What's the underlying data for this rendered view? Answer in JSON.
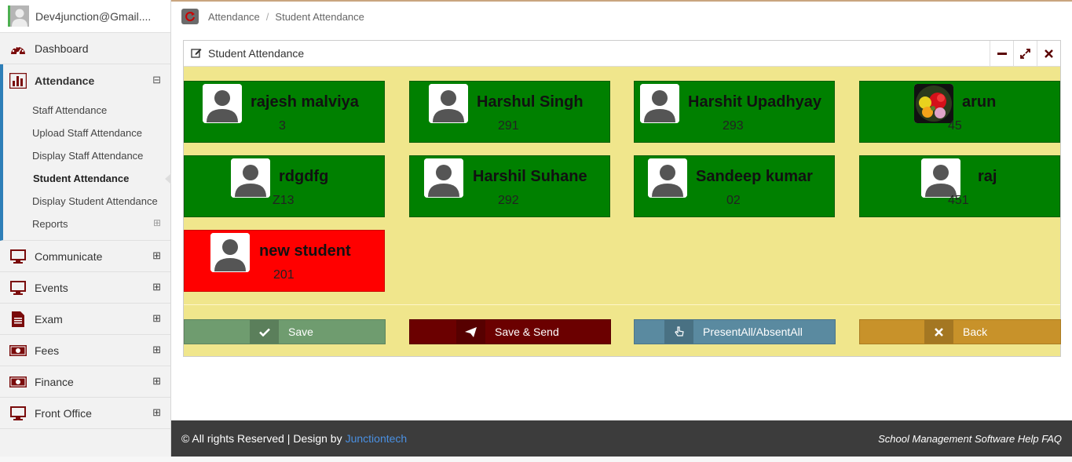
{
  "user": {
    "email": "Dev4junction@Gmail...."
  },
  "sidebar": {
    "dashboard": "Dashboard",
    "attendance": "Attendance",
    "attendance_toggle": "⊟",
    "submenu": [
      "Staff Attendance",
      "Upload Staff Attendance",
      "Display Staff Attendance",
      "Student Attendance",
      "Display Student Attendance",
      "Reports"
    ],
    "items": [
      {
        "label": "Communicate",
        "icon": "monitor-icon"
      },
      {
        "label": "Events",
        "icon": "monitor-icon"
      },
      {
        "label": "Exam",
        "icon": "document-icon"
      },
      {
        "label": "Fees",
        "icon": "money-icon"
      },
      {
        "label": "Finance",
        "icon": "money-icon"
      },
      {
        "label": "Front Office",
        "icon": "monitor-icon"
      }
    ],
    "expand_symbol": "⊞"
  },
  "breadcrumb": {
    "parent": "Attendance",
    "separator": "/",
    "current": "Student Attendance"
  },
  "panel": {
    "title": "Student Attendance",
    "tools": [
      "minimize-icon",
      "expand-icon",
      "close-icon"
    ]
  },
  "students": [
    {
      "name": "rajesh malviya",
      "roll": "3",
      "status": "present",
      "photo": "default"
    },
    {
      "name": "Harshul Singh",
      "roll": "291",
      "status": "present",
      "photo": "default"
    },
    {
      "name": "Harshit Upadhyay",
      "roll": "293",
      "status": "present",
      "photo": "default"
    },
    {
      "name": "arun",
      "roll": "45",
      "status": "present",
      "photo": "flowers"
    },
    {
      "name": "rdgdfg",
      "roll": "Z13",
      "status": "present",
      "photo": "default"
    },
    {
      "name": "Harshil Suhane",
      "roll": "292",
      "status": "present",
      "photo": "default"
    },
    {
      "name": "Sandeep kumar",
      "roll": "02",
      "status": "present",
      "photo": "default"
    },
    {
      "name": "raj",
      "roll": "451",
      "status": "present",
      "photo": "default"
    },
    {
      "name": "new student",
      "roll": "201",
      "status": "absent",
      "photo": "default"
    }
  ],
  "actions": {
    "save": "Save",
    "save_send": "Save & Send",
    "toggle_all": "PresentAll/AbsentAll",
    "back": "Back"
  },
  "colors": {
    "present": "#008000",
    "absent": "#ff0000",
    "panel_bg": "#f0e68c",
    "save_btn": "#6f9c6f",
    "save_send_btn": "#6b0000",
    "toggle_btn": "#5a8aa0",
    "back_btn": "#c8922a"
  },
  "footer": {
    "left": "© All rights Reserved | Design by",
    "link": "Junctiontech",
    "right": "School Management Software Help FAQ"
  }
}
